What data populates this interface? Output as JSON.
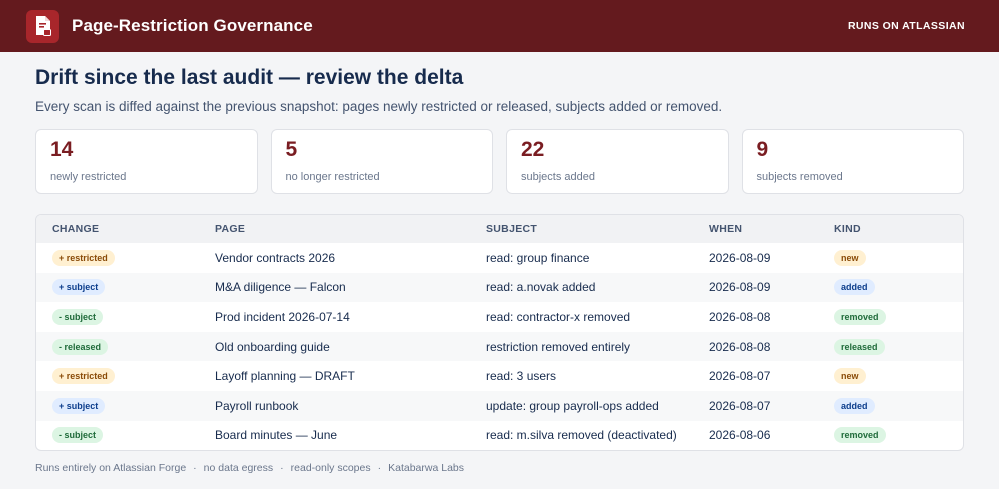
{
  "header": {
    "title": "Page-Restriction Governance",
    "runs_on": "RUNS ON ATLASSIAN",
    "logo_icon": "document-lock-icon"
  },
  "main": {
    "title": "Drift since the last audit — review the delta",
    "subtitle": "Every scan is diffed against the previous snapshot: pages newly restricted or released, subjects added or removed."
  },
  "stats": [
    {
      "value": "14",
      "label": "newly restricted"
    },
    {
      "value": "5",
      "label": "no longer restricted"
    },
    {
      "value": "22",
      "label": "subjects added"
    },
    {
      "value": "9",
      "label": "subjects removed"
    }
  ],
  "table": {
    "headers": [
      "CHANGE",
      "PAGE",
      "SUBJECT",
      "WHEN",
      "KIND"
    ],
    "rows": [
      {
        "change": "+ restricted",
        "change_type": "restricted",
        "page": "Vendor contracts 2026",
        "subject": "read: group finance",
        "when": "2026-08-09",
        "kind": "new"
      },
      {
        "change": "+ subject",
        "change_type": "subject",
        "page": "M&A diligence — Falcon",
        "subject": "read: a.novak added",
        "when": "2026-08-09",
        "kind": "added"
      },
      {
        "change": "- subject",
        "change_type": "minus",
        "page": "Prod incident 2026-07-14",
        "subject": "read: contractor-x removed",
        "when": "2026-08-08",
        "kind": "removed"
      },
      {
        "change": "- released",
        "change_type": "minus",
        "page": "Old onboarding guide",
        "subject": "restriction removed entirely",
        "when": "2026-08-08",
        "kind": "released"
      },
      {
        "change": "+ restricted",
        "change_type": "restricted",
        "page": "Layoff planning — DRAFT",
        "subject": "read: 3 users",
        "when": "2026-08-07",
        "kind": "new"
      },
      {
        "change": "+ subject",
        "change_type": "subject",
        "page": "Payroll runbook",
        "subject": "update: group payroll-ops added",
        "when": "2026-08-07",
        "kind": "added"
      },
      {
        "change": "- subject",
        "change_type": "minus",
        "page": "Board minutes — June",
        "subject": "read: m.silva removed (deactivated)",
        "when": "2026-08-06",
        "kind": "removed"
      }
    ]
  },
  "footer": {
    "items": [
      "Runs entirely on Atlassian Forge",
      "no data egress",
      "read-only scopes",
      "Katabarwa Labs"
    ],
    "separator": "·"
  },
  "colors": {
    "header_bg": "#641a1e",
    "accent": "#7a1d22"
  }
}
